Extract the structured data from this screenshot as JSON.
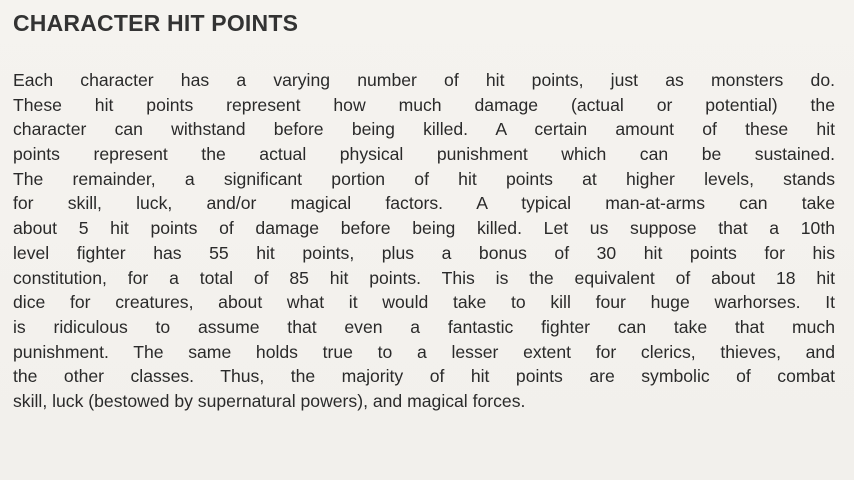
{
  "section": {
    "heading": "CHARACTER HIT POINTS",
    "paragraph_lines": [
      "Each character has a varying number of hit points, just as monsters do.",
      "These hit points represent how much damage (actual or potential) the",
      "character can withstand before being killed. A certain amount of these hit",
      "points represent the actual physical punishment which can be sustained.",
      "The remainder, a significant portion of hit points at higher levels, stands",
      "for skill, luck, and/or magical factors. A typical man-at-arms can take",
      "about 5 hit points of damage before being killed. Let us suppose that a 10th",
      "level fighter has 55 hit points, plus a bonus of 30 hit points for his",
      "constitution, for a total of 85 hit points. This is the equivalent of about 18 hit",
      "dice for creatures, about what it would take to kill four huge warhorses. It",
      "is ridiculous to assume that even a fantastic fighter can take that much",
      "punishment. The same holds true to a lesser extent for clerics, thieves, and",
      "the other classes. Thus, the majority of hit points are symbolic of combat",
      "skill, luck (bestowed by supernatural powers), and magical forces."
    ]
  }
}
